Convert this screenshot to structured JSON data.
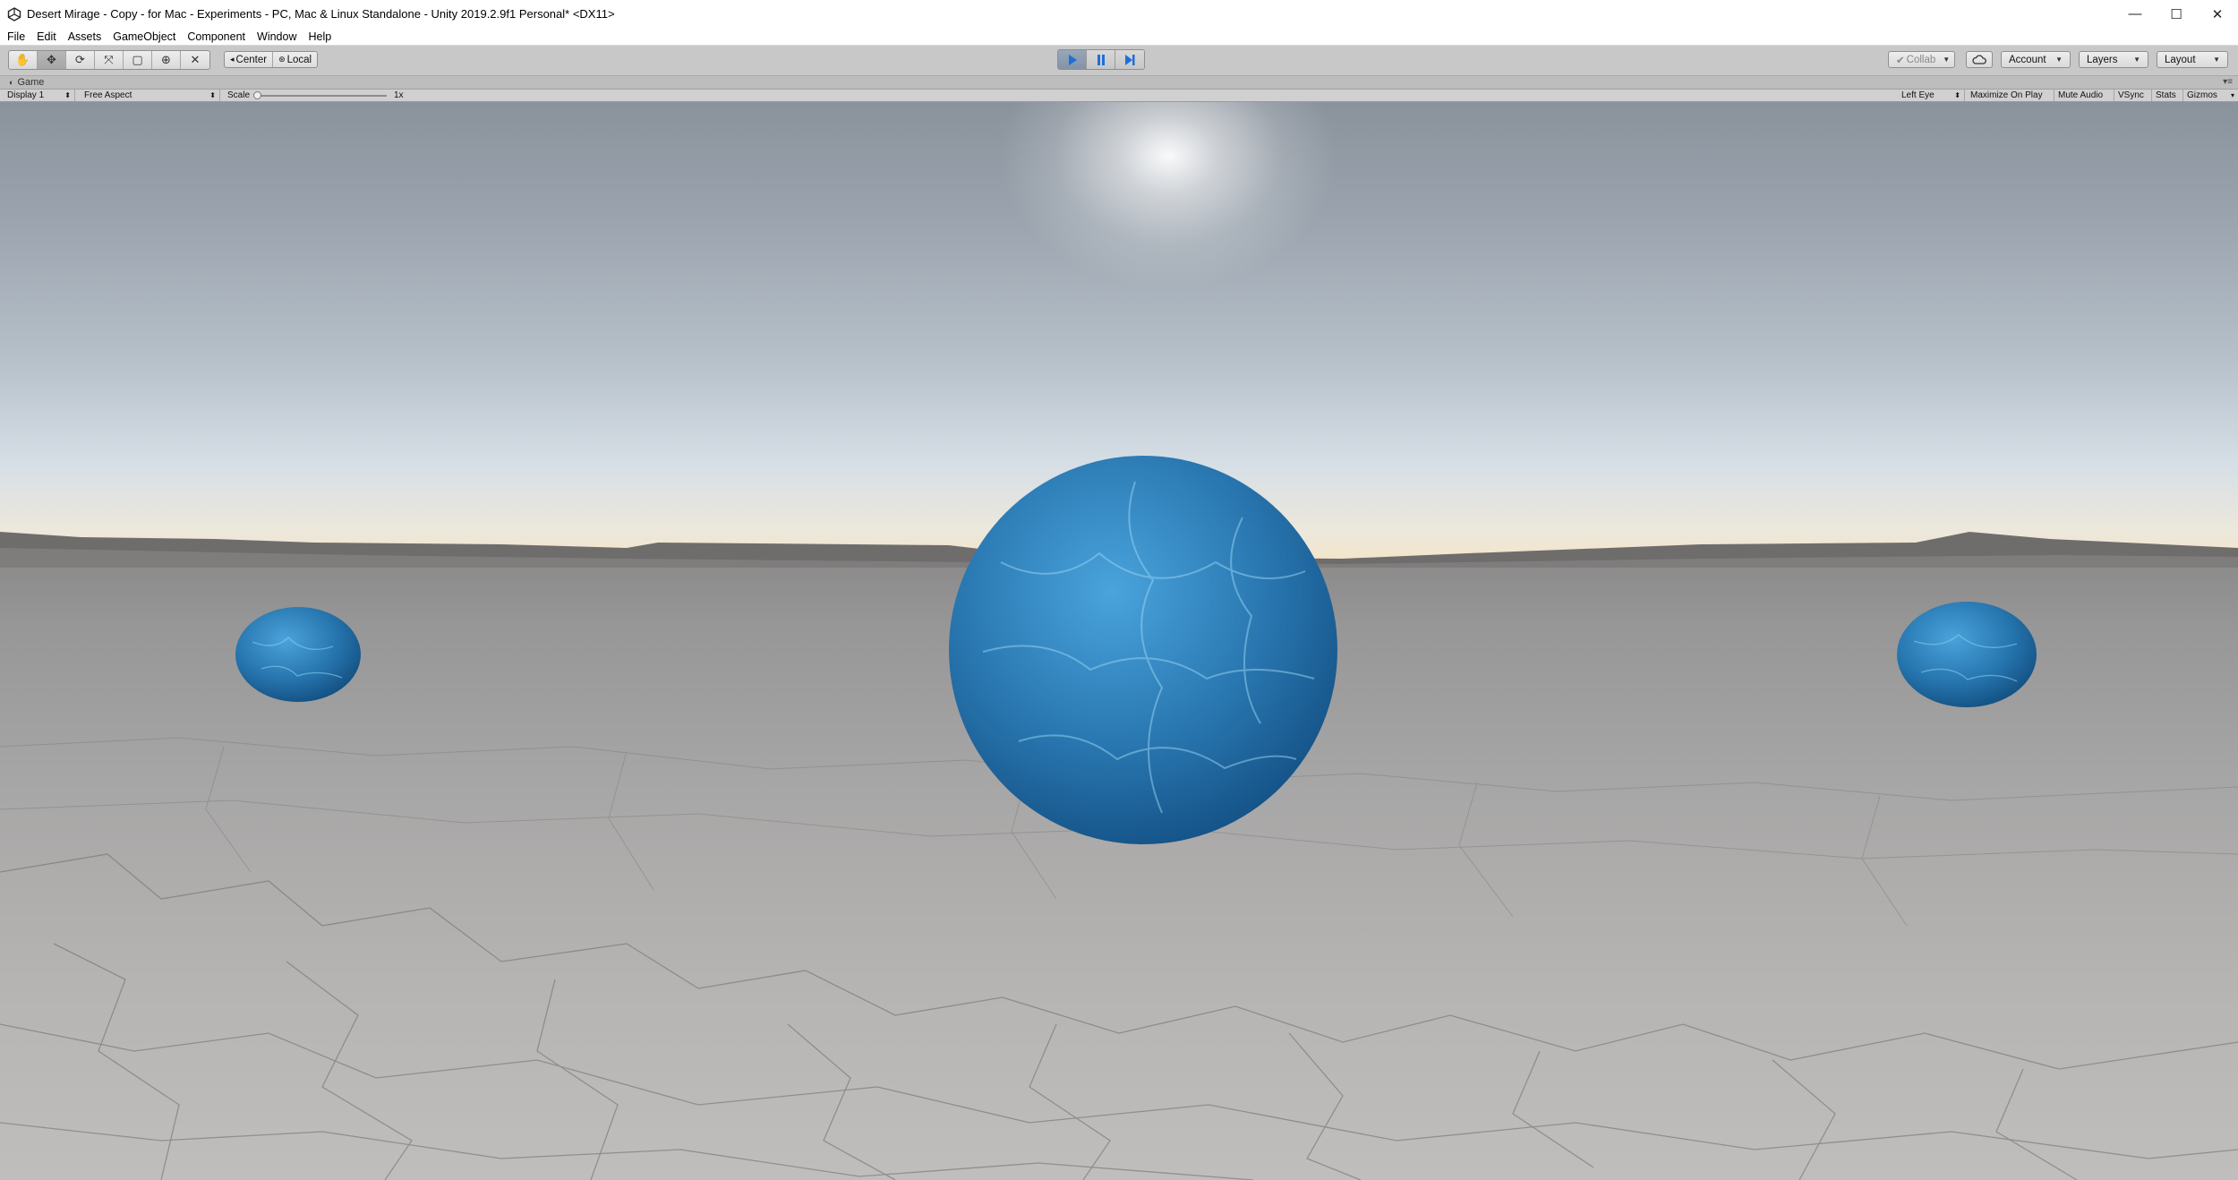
{
  "window": {
    "title": "Desert Mirage - Copy - for Mac - Experiments - PC, Mac & Linux Standalone - Unity 2019.2.9f1 Personal* <DX11>",
    "app_icon": "unity-icon",
    "controls": {
      "minimize": "—",
      "maximize": "☐",
      "close": "✕"
    }
  },
  "menu": [
    "File",
    "Edit",
    "Assets",
    "GameObject",
    "Component",
    "Window",
    "Help"
  ],
  "toolbar": {
    "tools": [
      {
        "name": "hand-tool-icon",
        "glyph": "✋"
      },
      {
        "name": "move-tool-icon",
        "glyph": "✥"
      },
      {
        "name": "rotate-tool-icon",
        "glyph": "⟳"
      },
      {
        "name": "scale-tool-icon",
        "glyph": "⤧"
      },
      {
        "name": "rect-tool-icon",
        "glyph": "▢"
      },
      {
        "name": "transform-tool-icon",
        "glyph": "⊕"
      },
      {
        "name": "custom-tool-icon",
        "glyph": "✕"
      }
    ],
    "active_tool": 1,
    "pivot_mode": "Center",
    "pivot_rotation": "Local",
    "play_state": "playing",
    "collab": "Collab",
    "account": "Account",
    "layers": "Layers",
    "layout": "Layout",
    "accent_color": "#8494a8"
  },
  "game_view": {
    "tab_label": "Game",
    "display": "Display 1",
    "aspect": "Free Aspect",
    "scale_label": "Scale",
    "scale_value": "1x",
    "scale_level": 0,
    "eye": "Left Eye",
    "maximize_on_play": "Maximize On Play",
    "mute_audio": "Mute Audio",
    "vsync": "VSync",
    "stats": "Stats",
    "gizmos": "Gizmos"
  },
  "scene": {
    "objects": [
      "blue-sphere-left",
      "blue-sphere-center",
      "blue-sphere-right"
    ],
    "sphere_color": "#2f7fb8",
    "sky_color": "#9aa4ae",
    "ground_color": "#a8a6a5"
  }
}
